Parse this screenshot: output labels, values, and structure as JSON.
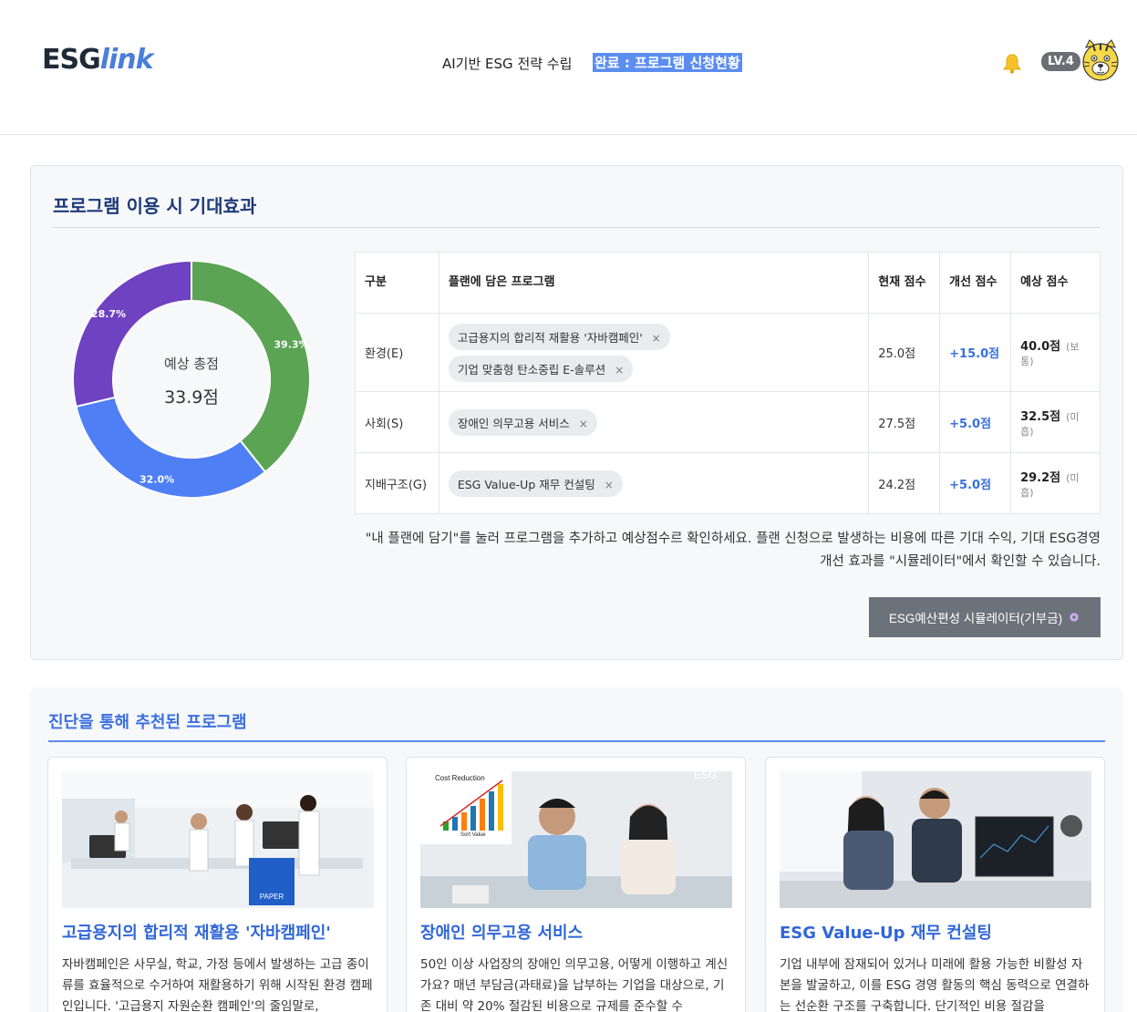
{
  "header": {
    "logo_prefix": "ESG",
    "logo_suffix": "link",
    "nav_text": "AI기반 ESG 전략 수립",
    "nav_status": "완료 : 프로그램 신청현황",
    "level": "LV.4",
    "bell_icon": "bell-icon",
    "avatar_icon": "tiger-avatar-icon"
  },
  "effect": {
    "title": "프로그램 이용 시 기대효과",
    "donut": {
      "center_label": "예상 총점",
      "center_value": "33.9점"
    },
    "table": {
      "headers": [
        "구분",
        "플랜에 담은 프로그램",
        "현재 점수",
        "개선 점수",
        "예상 점수"
      ],
      "rows": [
        {
          "category": "환경(E)",
          "programs": [
            "고급용지의 합리적 재활용 '자바캠페인'",
            "기업 맞춤형 탄소중립 E-솔루션"
          ],
          "current": "25.0점",
          "improve": "+15.0점",
          "expect": "40.0점",
          "expect_note": "(보통)"
        },
        {
          "category": "사회(S)",
          "programs": [
            "장애인 의무고용 서비스"
          ],
          "current": "27.5점",
          "improve": "+5.0점",
          "expect": "32.5점",
          "expect_note": "(미흡)"
        },
        {
          "category": "지배구조(G)",
          "programs": [
            "ESG Value-Up 재무 컨설팅"
          ],
          "current": "24.2점",
          "improve": "+5.0점",
          "expect": "29.2점",
          "expect_note": "(미흡)"
        }
      ],
      "chip_remove_glyph": "×"
    },
    "note": "\"내 플랜에 담기\"를 눌러 프로그램을 추가하고 예상점수르 확인하세요. 플랜 신청으로 발생하는 비용에 따른 기대 수익, 기대 ESG경영개선 효과를 \"시뮬레이터\"에서 확인할 수 있습니다.",
    "simulator_button": "ESG예산편성 시뮬레이터(기부금)"
  },
  "chart_data": {
    "type": "pie",
    "categories": [
      "환경(E)",
      "사회(S)",
      "지배구조(G)"
    ],
    "values": [
      39.3,
      32.0,
      28.7
    ],
    "labels": [
      "39.3%",
      "32.0%",
      "28.7%"
    ],
    "colors": [
      "#5aa454",
      "#4f7ff5",
      "#6f42c1"
    ]
  },
  "recommended": {
    "title": "진단을 통해 추천된 프로그램",
    "cards": [
      {
        "title": "고급용지의 합리적 재활용 '자바캠페인'",
        "desc": "자바캠페인은 사무실, 학교, 가정 등에서 발생하는 고급 종이류를 효율적으로 수거하여 재활용하기 위해 시작된 환경 캠페인입니다. '고급용지 자원순환 캠페인'의 줄임말로,",
        "img_caption": "PAPER"
      },
      {
        "title": "장애인 의무고용 서비스",
        "desc": "50인 이상 사업장의 장애인 의무고용, 어떻게 이행하고 계신가요? 매년 부담금(과태료)을 납부하는 기업을 대상으로, 기존 대비 약 20% 절감된 비용으로 규제를 준수할 수",
        "img_caption": "Cost Reduction",
        "img_sub": "Sort Value",
        "img_tag": "ESG"
      },
      {
        "title": "ESG Value-Up 재무 컨설팅",
        "desc": "기업 내부에 잠재되어 있거나 미래에 활용 가능한 비활성 자본을 발굴하고, 이를 ESG 경영 활동의 핵심 동력으로 연결하는 선순환 구조를 구축합니다. 단기적인 비용 절감을"
      }
    ]
  }
}
